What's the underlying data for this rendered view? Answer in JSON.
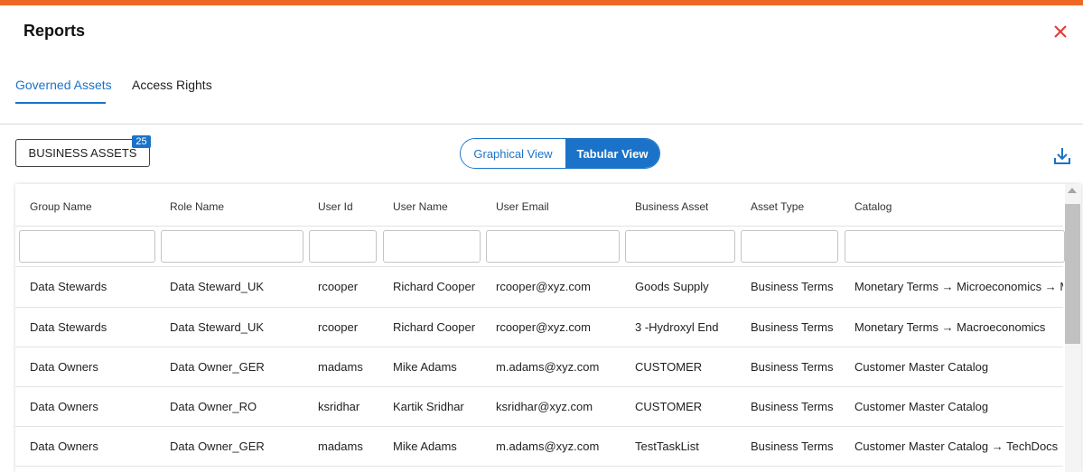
{
  "header": {
    "title": "Reports"
  },
  "tabs": [
    {
      "label": "Governed Assets",
      "active": true
    },
    {
      "label": "Access Rights",
      "active": false
    }
  ],
  "toolbar": {
    "assets_button_label": "BUSINESS ASSETS",
    "assets_count": "25",
    "view_options": [
      "Graphical View",
      "Tabular View"
    ],
    "selected_view": "Tabular View"
  },
  "table": {
    "columns": [
      "Group Name",
      "Role Name",
      "User Id",
      "User Name",
      "User Email",
      "Business Asset",
      "Asset Type",
      "Catalog"
    ],
    "rows": [
      [
        "Data Stewards",
        "Data Steward_UK",
        "rcooper",
        "Richard Cooper",
        "rcooper@xyz.com",
        "Goods Supply",
        "Business Terms",
        "Monetary Terms → Microeconomics → Micr"
      ],
      [
        "Data Stewards",
        "Data Steward_UK",
        "rcooper",
        "Richard Cooper",
        "rcooper@xyz.com",
        "3 -Hydroxyl End",
        "Business Terms",
        "Monetary Terms → Macroeconomics"
      ],
      [
        "Data Owners",
        "Data Owner_GER",
        "madams",
        "Mike Adams",
        "m.adams@xyz.com",
        "CUSTOMER",
        "Business Terms",
        "Customer Master Catalog"
      ],
      [
        "Data Owners",
        "Data Owner_RO",
        "ksridhar",
        "Kartik Sridhar",
        "ksridhar@xyz.com",
        "CUSTOMER",
        "Business Terms",
        "Customer Master Catalog"
      ],
      [
        "Data Owners",
        "Data Owner_GER",
        "madams",
        "Mike Adams",
        "m.adams@xyz.com",
        "TestTaskList",
        "Business Terms",
        "Customer Master Catalog → TechDocs"
      ]
    ]
  },
  "colors": {
    "accent": "#1a73c8",
    "top_bar": "#ee6a24",
    "close": "#e53935"
  },
  "icons": {
    "close": "close-icon",
    "download": "download-icon"
  }
}
